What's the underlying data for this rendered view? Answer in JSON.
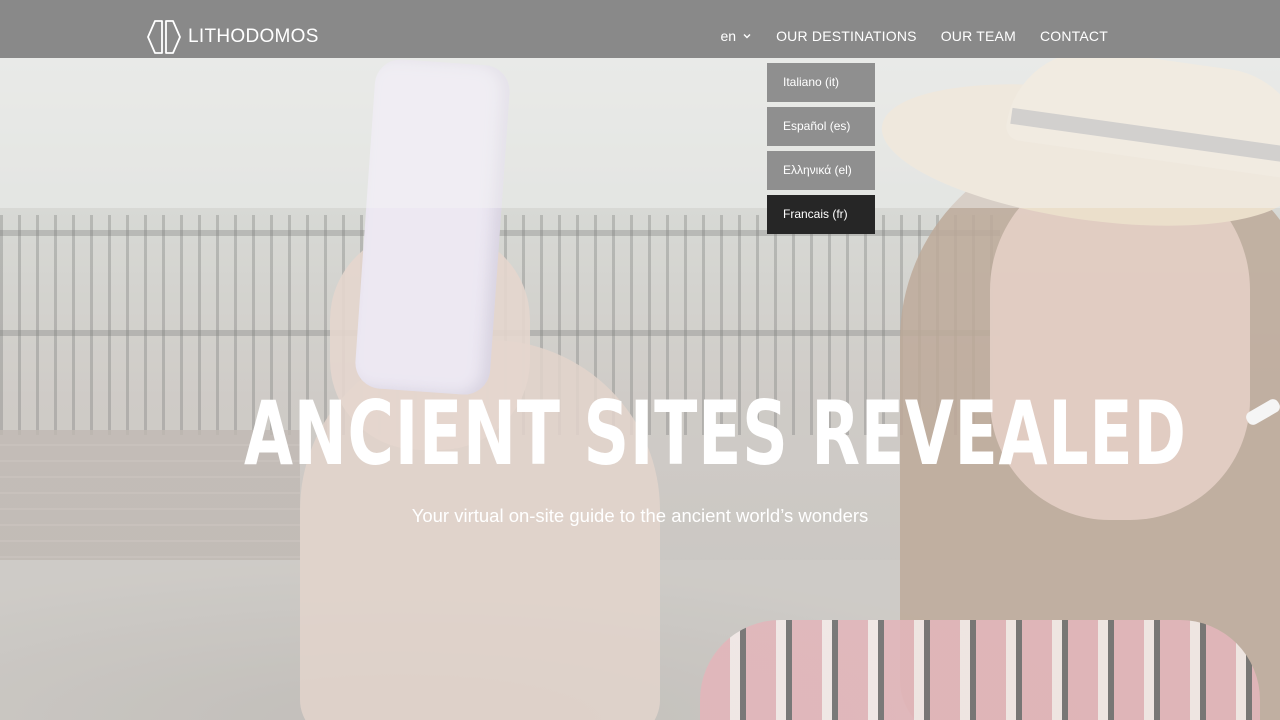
{
  "brand": {
    "name": "LITHODOMOS"
  },
  "nav": {
    "language": "en",
    "items": [
      "OUR DESTINATIONS",
      "OUR TEAM",
      "CONTACT"
    ]
  },
  "language_menu": [
    {
      "label": "Italiano (it)",
      "active": false
    },
    {
      "label": "Español (es)",
      "active": false
    },
    {
      "label": "Ελληνικά (el)",
      "active": false
    },
    {
      "label": "Francais (fr)",
      "active": true
    }
  ],
  "hero": {
    "headline": "ANCIENT SITES REVEALED",
    "subline": "Your virtual on-site guide to the ancient world’s wonders"
  },
  "colors": {
    "navbar": "#898989",
    "dropdown_item": "#8f8f8f",
    "dropdown_active": "#262626",
    "text": "#ffffff"
  }
}
